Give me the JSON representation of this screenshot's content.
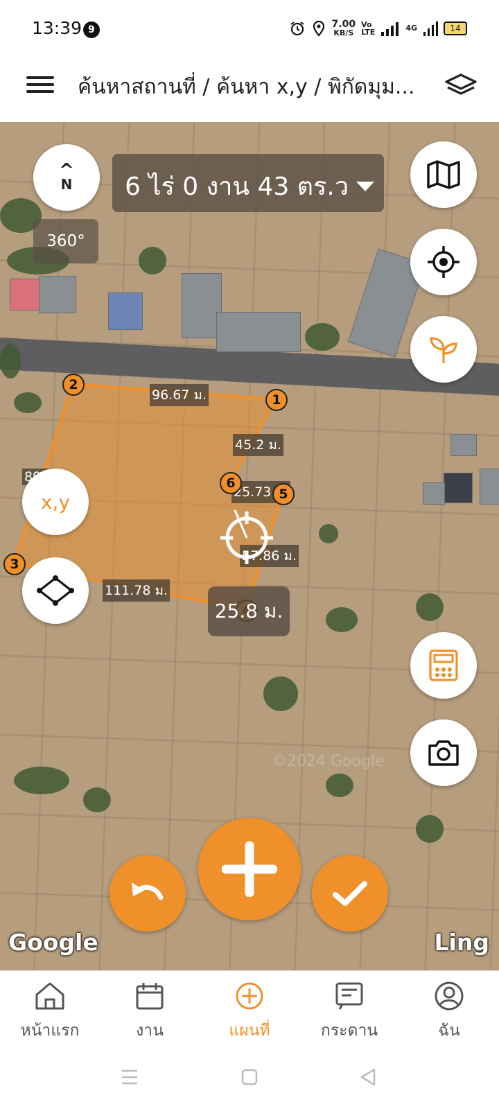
{
  "status": {
    "time": "13:39",
    "notif_count": "9",
    "net_speed_value": "7.00",
    "net_speed_unit": "KB/S",
    "volte_top": "Vo",
    "volte_bottom": "LTE",
    "network": "4G",
    "battery": "14"
  },
  "header": {
    "title": "ค้นหาสถานที่ / ค้นหา x,y / พิกัดมุม...",
    "menu_icon": "hamburger-menu-icon",
    "layers_icon": "layers-icon"
  },
  "map": {
    "compass_symbol": "^",
    "compass_n": "N",
    "btn_360": "360°",
    "area": "6 ไร่ 0 งาน 43 ตร.ว",
    "xy_label": "x,y",
    "current_measure": "25.8 ม.",
    "distances": [
      "96.67 ม.",
      "45.2 ม.",
      "89.8",
      "25.73 ม.",
      "57.86 ม.",
      "111.78 ม."
    ],
    "vertices": [
      "1",
      "2",
      "3",
      "4",
      "5",
      "6"
    ],
    "copyright": "©2024 Google",
    "google_logo": "Google",
    "ling_logo": "Ling",
    "accent_color": "#f0902a"
  },
  "nav": {
    "items": [
      {
        "label": "หน้าแรก",
        "icon": "home-icon"
      },
      {
        "label": "งาน",
        "icon": "calendar-icon"
      },
      {
        "label": "แผนที่",
        "icon": "add-circle-icon"
      },
      {
        "label": "กระดาน",
        "icon": "board-icon"
      },
      {
        "label": "ฉัน",
        "icon": "user-icon"
      }
    ],
    "active": "แผนที่"
  }
}
